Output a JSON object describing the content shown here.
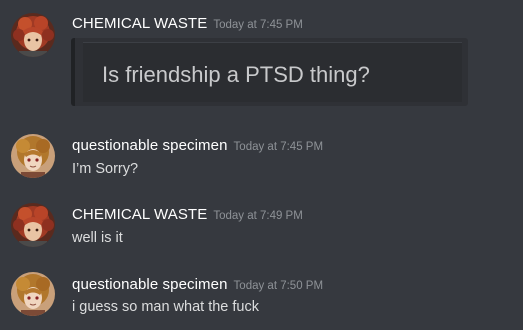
{
  "messages": [
    {
      "username": "CHEMICAL WASTE",
      "timestamp": "Today at 7:45 PM",
      "embed_text": "Is friendship a PTSD thing?"
    },
    {
      "username": "questionable specimen",
      "timestamp": "Today at 7:45 PM",
      "text": "I’m Sorry?"
    },
    {
      "username": "CHEMICAL WASTE",
      "timestamp": "Today at 7:49 PM",
      "text": "well is it"
    },
    {
      "username": "questionable specimen",
      "timestamp": "Today at 7:50 PM",
      "text": "i guess so man what the fuck"
    }
  ],
  "colors": {
    "background": "#36393f",
    "username": "#ffffff",
    "timestamp": "#8e9297",
    "message_text": "#dcddde",
    "embed_background": "#2f3136"
  }
}
